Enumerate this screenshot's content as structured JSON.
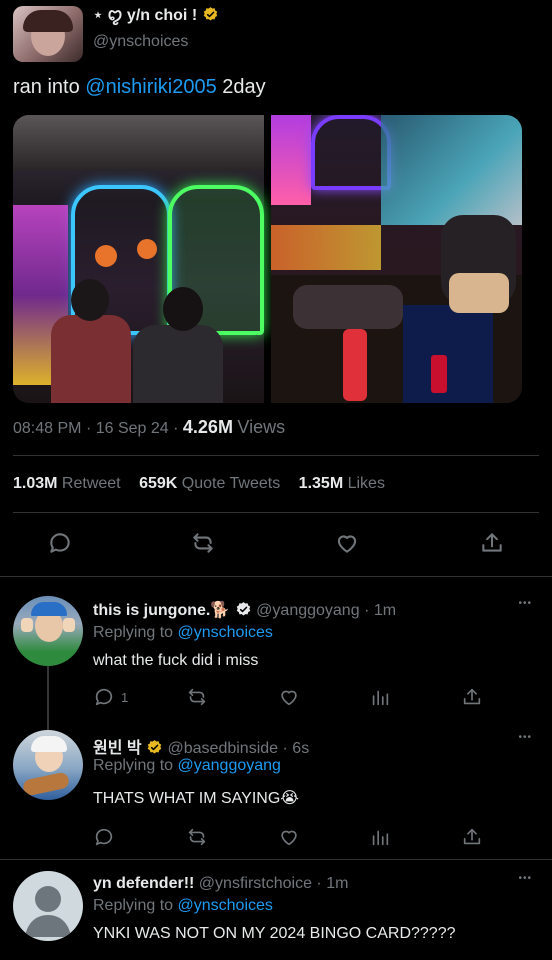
{
  "tweet": {
    "author_name": "⋆ ꨄ y/n choi !",
    "author_handle": "@ynschoices",
    "text_prefix": "ran into ",
    "mention": "@nishiriki2005",
    "text_suffix": " 2day",
    "time": "08:48 PM",
    "sep1": "·",
    "date": "16 Sep 24",
    "sep2": "·",
    "views_count": "4.26M",
    "views_label": "Views",
    "retweets_count": "1.03M",
    "retweets_label": "Retweet",
    "quotes_count": "659K",
    "quotes_label": "Quote Tweets",
    "likes_count": "1.35M",
    "likes_label": "Likes"
  },
  "replies": [
    {
      "name": "this is jungone.🐕",
      "handle": "@yanggoyang",
      "time": "· 1m",
      "replying_label": "Replying to",
      "replying_to": "@ynschoices",
      "text": "what the fuck did i miss",
      "reply_count": "1"
    },
    {
      "name": "원빈 박",
      "handle": "@basedbinside",
      "time": "· 6s",
      "replying_label": "Replying to",
      "replying_to": "@yanggoyang",
      "text": "THATS WHAT IM SAYING😭"
    },
    {
      "name": "yn defender!!",
      "handle": "@ynsfirstchoice",
      "time": "· 1m",
      "replying_label": "Replying to",
      "replying_to": "@ynschoices",
      "text": "YNKI WAS NOT ON MY 2024 BINGO CARD?????"
    }
  ],
  "more_glyph": "•••",
  "colors": {
    "background": "#000000",
    "link": "#1d9bf0",
    "muted": "#71767b",
    "divider": "#2f3336",
    "verified_blue": "#1d9bf0",
    "verified_gold": "#e8b923"
  },
  "icons": [
    "reply-icon",
    "retweet-icon",
    "like-icon",
    "share-icon",
    "analytics-icon",
    "verified-badge-icon",
    "more-icon",
    "default-avatar-icon"
  ]
}
